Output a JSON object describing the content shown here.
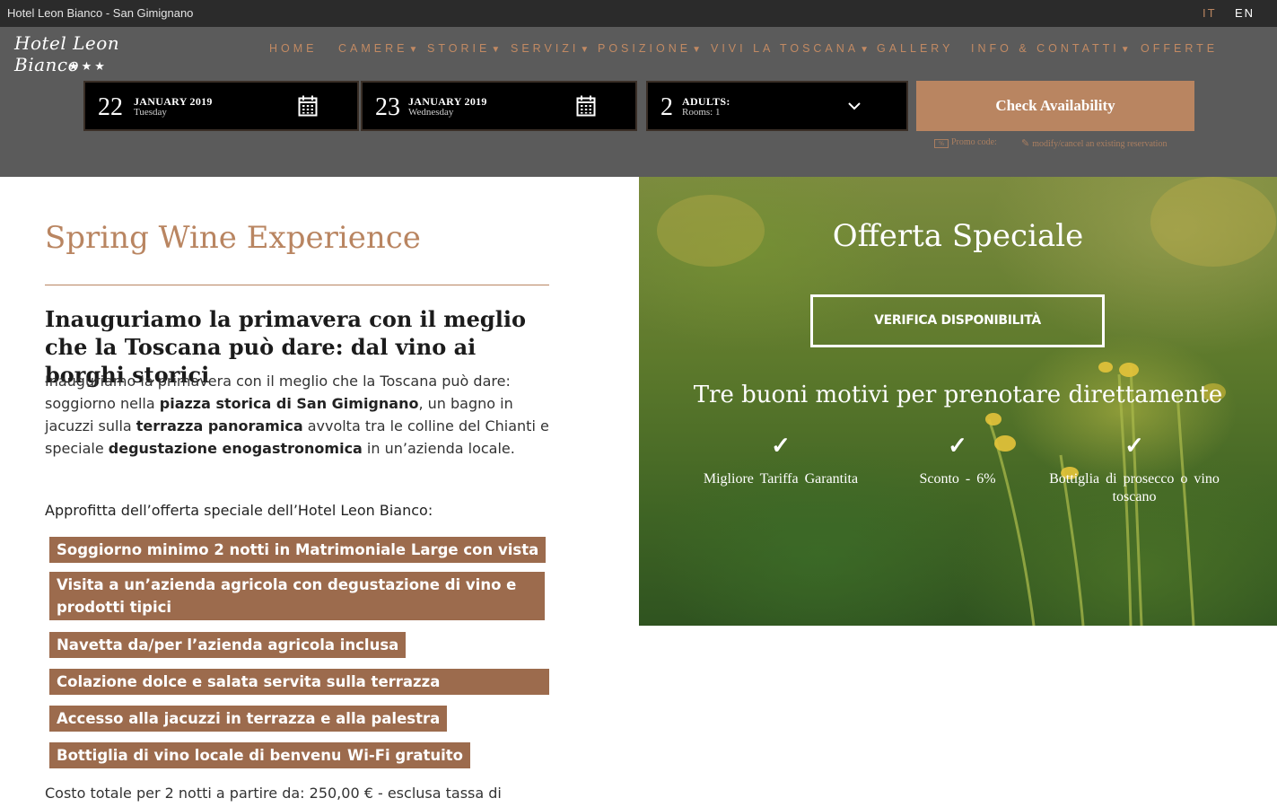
{
  "topbar": {
    "site_title": "Hotel Leon Bianco - San Gimignano",
    "lang_it": "IT",
    "lang_en": "EN"
  },
  "logo": {
    "name": "Hotel Leon Bianco",
    "stars": "★★★"
  },
  "nav": [
    {
      "label": "HOME",
      "has_dropdown": false
    },
    {
      "label": "CAMERE",
      "has_dropdown": true
    },
    {
      "label": "STORIE",
      "has_dropdown": true
    },
    {
      "label": "SERVIZI",
      "has_dropdown": true
    },
    {
      "label": "POSIZIONE",
      "has_dropdown": true
    },
    {
      "label": "VIVI LA TOSCANA",
      "has_dropdown": true
    },
    {
      "label": "GALLERY",
      "has_dropdown": false
    },
    {
      "label": "INFO & CONTATTI",
      "has_dropdown": true
    },
    {
      "label": "OFFERTE",
      "has_dropdown": false
    }
  ],
  "booking": {
    "checkin": {
      "day": "22",
      "month": "JANUARY 2019",
      "weekday": "Tuesday",
      "icon": "calendar-icon"
    },
    "checkout": {
      "day": "23",
      "month": "JANUARY 2019",
      "weekday": "Wednesday",
      "icon": "calendar-icon"
    },
    "guests": {
      "count": "2",
      "label": "ADULTS:",
      "rooms": "Rooms: 1",
      "icon": "chevron-down-icon"
    },
    "check_button": "Check Availability",
    "promo_label": "Promo code:",
    "modify_label": "modify/cancel an existing reservation"
  },
  "offer": {
    "title": "Spring Wine Experience",
    "subtitle": "Inauguriamo la primavera con il meglio che la Toscana può dare: dal vino ai borghi storici",
    "intro_1": "Inauguriamo la primavera con il meglio che la Toscana può dare: soggiorno nella ",
    "intro_b1": "piazza storica di San Gimignano",
    "intro_2": ", un bagno in jacuzzi sulla ",
    "intro_b2": "terrazza panoramica",
    "intro_3": " avvolta tra le colline del Chianti e speciale ",
    "intro_b3": "degustazione enogastronomica",
    "intro_4": " in un’azienda locale.",
    "approfitta": "Approfitta dell’offerta speciale dell’Hotel Leon Bianco:",
    "tags": [
      "Soggiorno minimo 2 notti in Matrimoniale Large con vista",
      "Visita a un’azienda agricola con degustazione di vino e prodotti tipici",
      "Navetta da/per l’azienda agricola inclusa",
      "Colazione dolce e salata servita sulla terrazza panoramica",
      "Accesso alla jacuzzi in terrazza e alla palestra",
      "Bottiglia di vino locale di benvenuto",
      "Wi-Fi gratuito"
    ],
    "cost": "Costo totale per 2 notti a partire da: 250,00 € - esclusa tassa di"
  },
  "hero": {
    "title": "Offerta Speciale",
    "button": "VERIFICA DISPONIBILITÀ",
    "heading": "Tre buoni motivi per prenotare direttamente",
    "reasons": [
      {
        "icon": "check-icon",
        "text": "Migliore Tariffa Garantita"
      },
      {
        "icon": "check-icon",
        "text": "Sconto - 6%"
      },
      {
        "icon": "check-icon",
        "text": "Bottiglia di prosecco o vino toscano"
      }
    ]
  }
}
